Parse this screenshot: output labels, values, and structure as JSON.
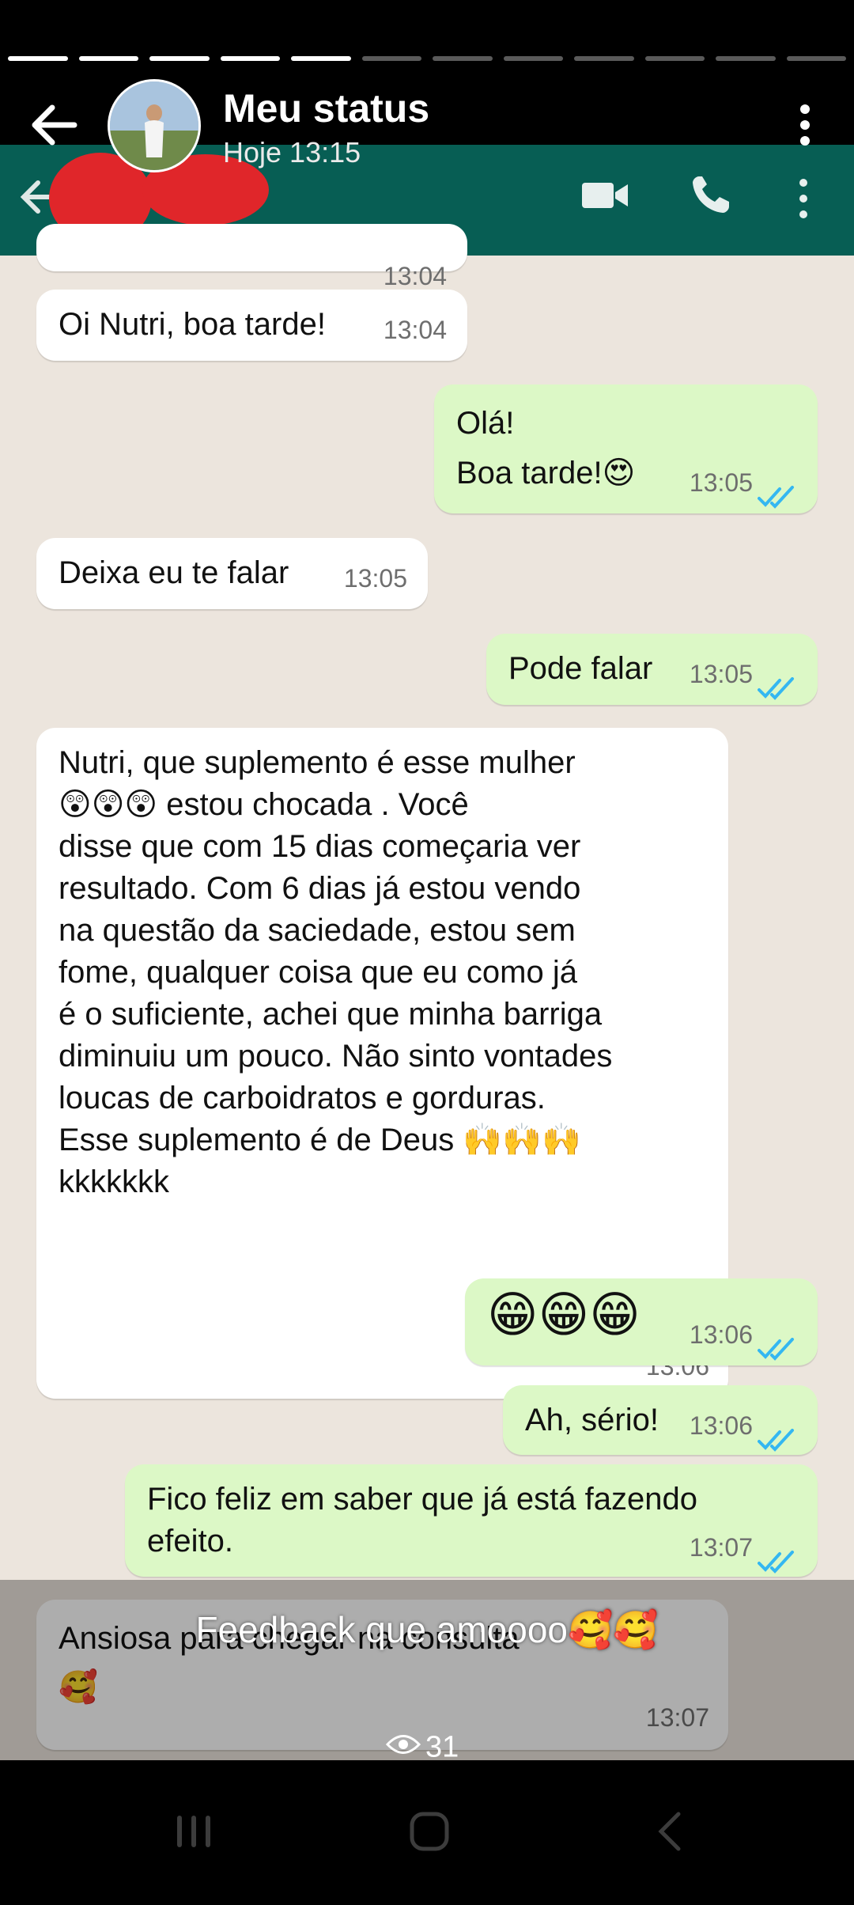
{
  "status": {
    "title": "Meu status",
    "time": "Hoje 13:15",
    "progress": {
      "total_segments": 12,
      "completed": 5
    },
    "caption": "Feedback que amoooo🥰🥰",
    "views": "31"
  },
  "chat": {
    "messages": [
      {
        "dir": "in",
        "text": "Oi Nutri, boa tarde!",
        "time": "13:04"
      },
      {
        "dir": "out",
        "text": "Olá!\nBoa tarde!😍",
        "time": "13:05"
      },
      {
        "dir": "in",
        "text": "Deixa eu te falar",
        "time": "13:05"
      },
      {
        "dir": "out",
        "text": "Pode falar",
        "time": "13:05"
      },
      {
        "dir": "in",
        "text": "Nutri, que suplemento é esse mulher\n😲😲😲 estou chocada . Você\ndisse que com 15 dias começaria ver\nresultado.  Com 6 dias já estou vendo\nna questão da saciedade, estou sem\nfome, qualquer coisa que eu como já\né o suficiente, achei que minha barriga\ndiminuiu um pouco. Não sinto vontades\nloucas de carboidratos e gorduras.\nEsse suplemento é de Deus 🙌🙌🙌\nkkkkkkk",
        "time": "13:06"
      },
      {
        "dir": "out",
        "text": "😁😁😁",
        "time": "13:06"
      },
      {
        "dir": "out",
        "text": "Ah, sério!",
        "time": "13:06"
      },
      {
        "dir": "out",
        "text": "Fico feliz em saber que já está fazendo\nefeito.",
        "time": "13:07"
      },
      {
        "dir": "in",
        "text": "Ansiosa para chegar na consulta\n🥰",
        "time": "13:07"
      }
    ],
    "partial_top_time": "13:04"
  },
  "colors": {
    "whatsapp_header": "#075e54",
    "chat_bg": "#ece5dd",
    "incoming": "#ffffff",
    "outgoing": "#dcf8c6",
    "read_ticks": "#34b7f1",
    "redaction": "#e0262a"
  },
  "icons": {
    "back": "arrow-left-icon",
    "more": "more-vertical-icon",
    "video": "video-camera-icon",
    "call": "phone-icon",
    "views": "eye-icon",
    "nav_recent": "recent-apps-icon",
    "nav_home": "home-icon",
    "nav_back": "nav-back-icon"
  }
}
